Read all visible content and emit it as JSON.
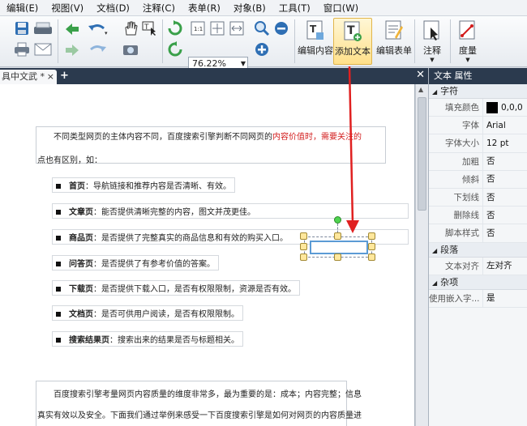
{
  "menu": [
    "编辑(E)",
    "视图(V)",
    "文档(D)",
    "注释(C)",
    "表单(R)",
    "对象(B)",
    "工具(T)",
    "窗口(W)"
  ],
  "toolbar": {
    "zoom": "76.22%",
    "edit_content": "编辑内容",
    "add_text": "添加文本",
    "edit_form": "编辑表单",
    "annotate": "注释",
    "measure": "度量"
  },
  "tab": {
    "label": "具中文武 *"
  },
  "document": {
    "intro_pre": "不同类型网页的主体内容不同，百度搜索引擎判断不同网页的",
    "intro_red": "内容价值时，需要关注的",
    "intro_line2": "点也有区别，如：",
    "bullets": [
      {
        "term": "首页",
        "desc": "：导航链接和推荐内容是否清晰、有效。"
      },
      {
        "term": "文章页",
        "desc": "：能否提供清晰完整的内容，图文并茂更佳。"
      },
      {
        "term": "商品页",
        "desc": "：是否提供了完整真实的商品信息和有效的购买入口。"
      },
      {
        "term": "问答页",
        "desc": "：是否提供了有参考价值的答案。"
      },
      {
        "term": "下载页",
        "desc": "：是否提供下载入口，是否有权限限制，资源是否有效。"
      },
      {
        "term": "文档页",
        "desc": "：是否可供用户阅读，是否有权限限制。"
      },
      {
        "term": "搜索结果页",
        "desc": "：搜索出来的结果是否与标题相关。"
      }
    ],
    "para2_line1": "百度搜索引擎考量网页内容质量的维度非常多，最为重要的是：成本；内容完整；信息",
    "para2_line2": "真实有效以及安全。下面我们通过举例来感受一下百度搜索引擎是如何对网页的内容质量进"
  },
  "panel": {
    "title": "文本 属性",
    "section_char": "字符",
    "fill_color_label": "填充颜色",
    "fill_color_value": "0,0,0",
    "font_label": "字体",
    "font_value": "Arial",
    "size_label": "字体大小",
    "size_value": "12 pt",
    "bold_label": "加粗",
    "bold_value": "否",
    "italic_label": "倾斜",
    "italic_value": "否",
    "underline_label": "下划线",
    "underline_value": "否",
    "strike_label": "删除线",
    "strike_value": "否",
    "script_label": "脚本样式",
    "script_value": "否",
    "section_para": "段落",
    "align_label": "文本对齐",
    "align_value": "左对齐",
    "section_misc": "杂项",
    "embed_label": "使用嵌入字...",
    "embed_value": "是"
  },
  "colors": {
    "accent_red": "#d21c1c",
    "arrow": "#e02020"
  }
}
